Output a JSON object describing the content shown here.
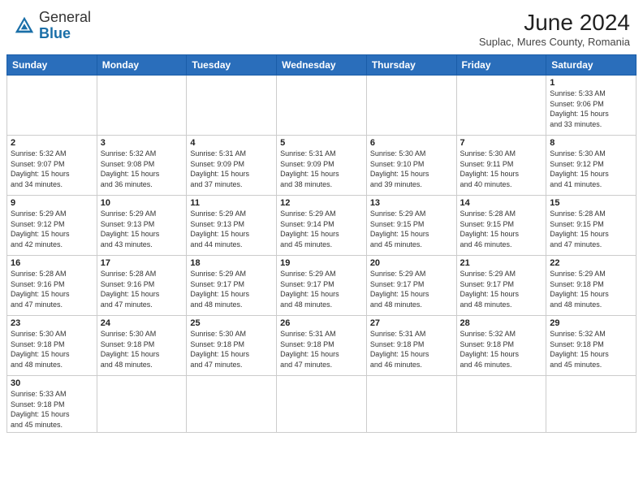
{
  "header": {
    "logo_general": "General",
    "logo_blue": "Blue",
    "month_year": "June 2024",
    "location": "Suplac, Mures County, Romania"
  },
  "weekdays": [
    "Sunday",
    "Monday",
    "Tuesday",
    "Wednesday",
    "Thursday",
    "Friday",
    "Saturday"
  ],
  "weeks": [
    [
      {
        "day": "",
        "info": ""
      },
      {
        "day": "",
        "info": ""
      },
      {
        "day": "",
        "info": ""
      },
      {
        "day": "",
        "info": ""
      },
      {
        "day": "",
        "info": ""
      },
      {
        "day": "",
        "info": ""
      },
      {
        "day": "1",
        "info": "Sunrise: 5:33 AM\nSunset: 9:06 PM\nDaylight: 15 hours\nand 33 minutes."
      }
    ],
    [
      {
        "day": "2",
        "info": "Sunrise: 5:32 AM\nSunset: 9:07 PM\nDaylight: 15 hours\nand 34 minutes."
      },
      {
        "day": "3",
        "info": "Sunrise: 5:32 AM\nSunset: 9:08 PM\nDaylight: 15 hours\nand 36 minutes."
      },
      {
        "day": "4",
        "info": "Sunrise: 5:31 AM\nSunset: 9:09 PM\nDaylight: 15 hours\nand 37 minutes."
      },
      {
        "day": "5",
        "info": "Sunrise: 5:31 AM\nSunset: 9:09 PM\nDaylight: 15 hours\nand 38 minutes."
      },
      {
        "day": "6",
        "info": "Sunrise: 5:30 AM\nSunset: 9:10 PM\nDaylight: 15 hours\nand 39 minutes."
      },
      {
        "day": "7",
        "info": "Sunrise: 5:30 AM\nSunset: 9:11 PM\nDaylight: 15 hours\nand 40 minutes."
      },
      {
        "day": "8",
        "info": "Sunrise: 5:30 AM\nSunset: 9:12 PM\nDaylight: 15 hours\nand 41 minutes."
      }
    ],
    [
      {
        "day": "9",
        "info": "Sunrise: 5:29 AM\nSunset: 9:12 PM\nDaylight: 15 hours\nand 42 minutes."
      },
      {
        "day": "10",
        "info": "Sunrise: 5:29 AM\nSunset: 9:13 PM\nDaylight: 15 hours\nand 43 minutes."
      },
      {
        "day": "11",
        "info": "Sunrise: 5:29 AM\nSunset: 9:13 PM\nDaylight: 15 hours\nand 44 minutes."
      },
      {
        "day": "12",
        "info": "Sunrise: 5:29 AM\nSunset: 9:14 PM\nDaylight: 15 hours\nand 45 minutes."
      },
      {
        "day": "13",
        "info": "Sunrise: 5:29 AM\nSunset: 9:15 PM\nDaylight: 15 hours\nand 45 minutes."
      },
      {
        "day": "14",
        "info": "Sunrise: 5:28 AM\nSunset: 9:15 PM\nDaylight: 15 hours\nand 46 minutes."
      },
      {
        "day": "15",
        "info": "Sunrise: 5:28 AM\nSunset: 9:15 PM\nDaylight: 15 hours\nand 47 minutes."
      }
    ],
    [
      {
        "day": "16",
        "info": "Sunrise: 5:28 AM\nSunset: 9:16 PM\nDaylight: 15 hours\nand 47 minutes."
      },
      {
        "day": "17",
        "info": "Sunrise: 5:28 AM\nSunset: 9:16 PM\nDaylight: 15 hours\nand 47 minutes."
      },
      {
        "day": "18",
        "info": "Sunrise: 5:29 AM\nSunset: 9:17 PM\nDaylight: 15 hours\nand 48 minutes."
      },
      {
        "day": "19",
        "info": "Sunrise: 5:29 AM\nSunset: 9:17 PM\nDaylight: 15 hours\nand 48 minutes."
      },
      {
        "day": "20",
        "info": "Sunrise: 5:29 AM\nSunset: 9:17 PM\nDaylight: 15 hours\nand 48 minutes."
      },
      {
        "day": "21",
        "info": "Sunrise: 5:29 AM\nSunset: 9:17 PM\nDaylight: 15 hours\nand 48 minutes."
      },
      {
        "day": "22",
        "info": "Sunrise: 5:29 AM\nSunset: 9:18 PM\nDaylight: 15 hours\nand 48 minutes."
      }
    ],
    [
      {
        "day": "23",
        "info": "Sunrise: 5:30 AM\nSunset: 9:18 PM\nDaylight: 15 hours\nand 48 minutes."
      },
      {
        "day": "24",
        "info": "Sunrise: 5:30 AM\nSunset: 9:18 PM\nDaylight: 15 hours\nand 48 minutes."
      },
      {
        "day": "25",
        "info": "Sunrise: 5:30 AM\nSunset: 9:18 PM\nDaylight: 15 hours\nand 47 minutes."
      },
      {
        "day": "26",
        "info": "Sunrise: 5:31 AM\nSunset: 9:18 PM\nDaylight: 15 hours\nand 47 minutes."
      },
      {
        "day": "27",
        "info": "Sunrise: 5:31 AM\nSunset: 9:18 PM\nDaylight: 15 hours\nand 46 minutes."
      },
      {
        "day": "28",
        "info": "Sunrise: 5:32 AM\nSunset: 9:18 PM\nDaylight: 15 hours\nand 46 minutes."
      },
      {
        "day": "29",
        "info": "Sunrise: 5:32 AM\nSunset: 9:18 PM\nDaylight: 15 hours\nand 45 minutes."
      }
    ],
    [
      {
        "day": "30",
        "info": "Sunrise: 5:33 AM\nSunset: 9:18 PM\nDaylight: 15 hours\nand 45 minutes."
      },
      {
        "day": "",
        "info": ""
      },
      {
        "day": "",
        "info": ""
      },
      {
        "day": "",
        "info": ""
      },
      {
        "day": "",
        "info": ""
      },
      {
        "day": "",
        "info": ""
      },
      {
        "day": "",
        "info": ""
      }
    ]
  ]
}
